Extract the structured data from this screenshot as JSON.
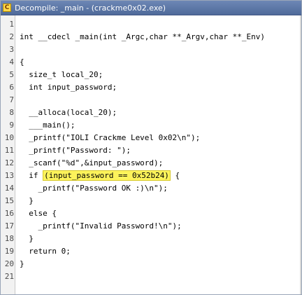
{
  "window": {
    "title": "Decompile: _main - (crackme0x02.exe)",
    "icon": "decompile-icon",
    "icon_glyph": "C",
    "accent": "#4f6a9a",
    "highlight_color": "#fdf35b"
  },
  "code": {
    "lines": [
      {
        "n": "1",
        "text": ""
      },
      {
        "n": "2",
        "text": "int __cdecl _main(int _Argc,char **_Argv,char **_Env)"
      },
      {
        "n": "3",
        "text": ""
      },
      {
        "n": "4",
        "text": "{"
      },
      {
        "n": "5",
        "text": "  size_t local_20;"
      },
      {
        "n": "6",
        "text": "  int input_password;"
      },
      {
        "n": "7",
        "text": ""
      },
      {
        "n": "8",
        "text": "  __alloca(local_20);"
      },
      {
        "n": "9",
        "text": "  ___main();"
      },
      {
        "n": "10",
        "text": "  _printf(\"IOLI Crackme Level 0x02\\n\");"
      },
      {
        "n": "11",
        "text": "  _printf(\"Password: \");"
      },
      {
        "n": "12",
        "text": "  _scanf(\"%d\",&input_password);"
      },
      {
        "n": "13",
        "pre": "  if ",
        "highlight": "(input_password == 0x52b24)",
        "post": " {"
      },
      {
        "n": "14",
        "text": "    _printf(\"Password OK :)\\n\");"
      },
      {
        "n": "15",
        "text": "  }"
      },
      {
        "n": "16",
        "text": "  else {"
      },
      {
        "n": "17",
        "text": "    _printf(\"Invalid Password!\\n\");"
      },
      {
        "n": "18",
        "text": "  }"
      },
      {
        "n": "19",
        "text": "  return 0;"
      },
      {
        "n": "20",
        "text": "}"
      },
      {
        "n": "21",
        "text": ""
      }
    ]
  }
}
